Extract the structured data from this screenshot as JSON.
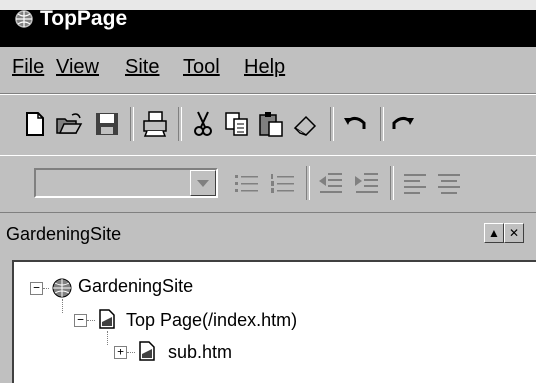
{
  "window": {
    "title": "TopPage",
    "icon": "site-globe-icon"
  },
  "menubar": {
    "items": [
      {
        "label": "File"
      },
      {
        "label": "View"
      },
      {
        "label": "Site"
      },
      {
        "label": "Tool"
      },
      {
        "label": "Help"
      }
    ]
  },
  "toolbar1": {
    "buttons": [
      "new-page-icon",
      "open-icon",
      "save-icon",
      "print-icon",
      "cut-icon",
      "copy-icon",
      "paste-icon",
      "eraser-icon",
      "undo-icon",
      "redo-icon"
    ]
  },
  "toolbar2": {
    "style_combo_value": "",
    "buttons": [
      "bulleted-list-icon",
      "numbered-list-icon",
      "decrease-indent-icon",
      "increase-indent-icon",
      "align-left-icon",
      "align-center-icon"
    ]
  },
  "pane": {
    "title": "GardeningSite",
    "controls": [
      "pane-maximize-icon",
      "pane-close-icon"
    ]
  },
  "tree": {
    "root": {
      "label": "GardeningSite",
      "expander": "−"
    },
    "child": {
      "label": "Top Page(/index.htm)",
      "expander": "−"
    },
    "grandchild": {
      "label": "sub.htm",
      "expander": "+"
    }
  },
  "colors": {
    "titlebar": "#000000",
    "face": "#c0c0c0"
  }
}
